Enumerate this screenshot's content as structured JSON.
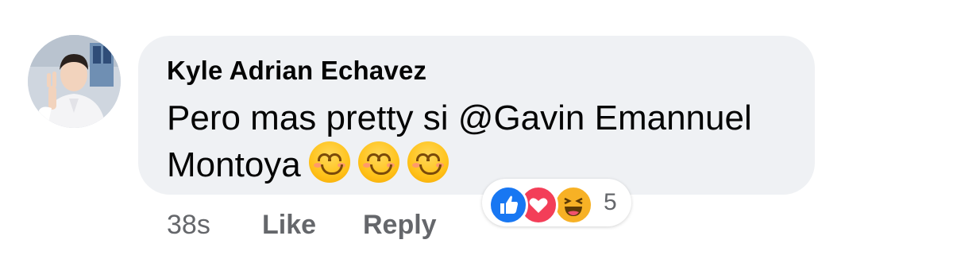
{
  "comment": {
    "author": "Kyle Adrian Echavez",
    "text": "Pero mas pretty si @Gavin Emannuel Montoya",
    "emojis": [
      "smiling-face-emoji",
      "smiling-face-emoji",
      "smiling-face-emoji"
    ],
    "timestamp": "38s",
    "like_label": "Like",
    "reply_label": "Reply"
  },
  "reactions": {
    "types": [
      "like-icon",
      "love-icon",
      "haha-icon"
    ],
    "count": "5"
  },
  "colors": {
    "bubble": "#eff1f4",
    "text": "#050505",
    "meta": "#65676b",
    "like": "#1877f2",
    "love": "#f33e58",
    "haha": "#f7b125"
  }
}
